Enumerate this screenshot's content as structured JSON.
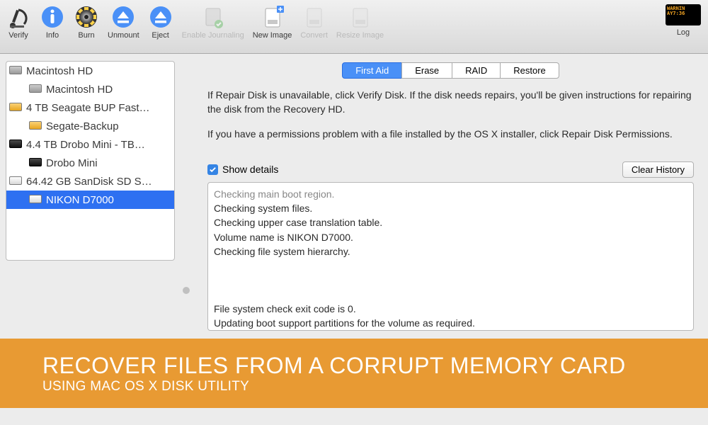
{
  "toolbar": {
    "items": [
      {
        "label": "Verify",
        "icon": "microscope",
        "enabled": true
      },
      {
        "label": "Info",
        "icon": "info",
        "enabled": true
      },
      {
        "label": "Burn",
        "icon": "burn",
        "enabled": true
      },
      {
        "label": "Unmount",
        "icon": "unmount",
        "enabled": true
      },
      {
        "label": "Eject",
        "icon": "eject",
        "enabled": true
      },
      {
        "label": "Enable Journaling",
        "icon": "journal",
        "enabled": false
      },
      {
        "label": "New Image",
        "icon": "newimage",
        "enabled": true
      },
      {
        "label": "Convert",
        "icon": "convert",
        "enabled": false
      },
      {
        "label": "Resize Image",
        "icon": "resize",
        "enabled": false
      }
    ],
    "log_label": "Log",
    "log_text": "WARNIN\nAY7:36"
  },
  "sidebar": {
    "disks": [
      {
        "label": "Macintosh HD",
        "child": false,
        "variant": "int",
        "selected": false
      },
      {
        "label": "Macintosh HD",
        "child": true,
        "variant": "int",
        "selected": false
      },
      {
        "label": "4 TB Seagate BUP Fast…",
        "child": false,
        "variant": "yellow",
        "selected": false
      },
      {
        "label": "Segate-Backup",
        "child": true,
        "variant": "yellow",
        "selected": false
      },
      {
        "label": "4.4 TB Drobo Mini - TB…",
        "child": false,
        "variant": "black",
        "selected": false
      },
      {
        "label": "Drobo Mini",
        "child": true,
        "variant": "black",
        "selected": false
      },
      {
        "label": "64.42 GB SanDisk SD S…",
        "child": false,
        "variant": "white",
        "selected": false
      },
      {
        "label": "NIKON D7000",
        "child": true,
        "variant": "white",
        "selected": true
      }
    ]
  },
  "tabs": [
    {
      "label": "First Aid",
      "active": true
    },
    {
      "label": "Erase",
      "active": false
    },
    {
      "label": "RAID",
      "active": false
    },
    {
      "label": "Restore",
      "active": false
    }
  ],
  "detail": {
    "para1": "If Repair Disk is unavailable, click Verify Disk. If the disk needs repairs, you'll be given instructions for repairing the disk from the Recovery HD.",
    "para2": "If you have a permissions problem with a file installed by the OS X installer, click Repair Disk Permissions.",
    "show_details": "Show details",
    "clear_history": "Clear History"
  },
  "log_lines": [
    "Checking main boot region.",
    "Checking system files.",
    "Checking upper case translation table.",
    "Volume name is NIKON D7000.",
    "Checking file system hierarchy.",
    "",
    "",
    "",
    "File system check exit code is 0.",
    "Updating boot support partitions for the volume as required."
  ],
  "banner": {
    "title": "RECOVER FILES FROM A CORRUPT MEMORY CARD",
    "subtitle": "USING MAC OS X DISK UTILITY"
  }
}
